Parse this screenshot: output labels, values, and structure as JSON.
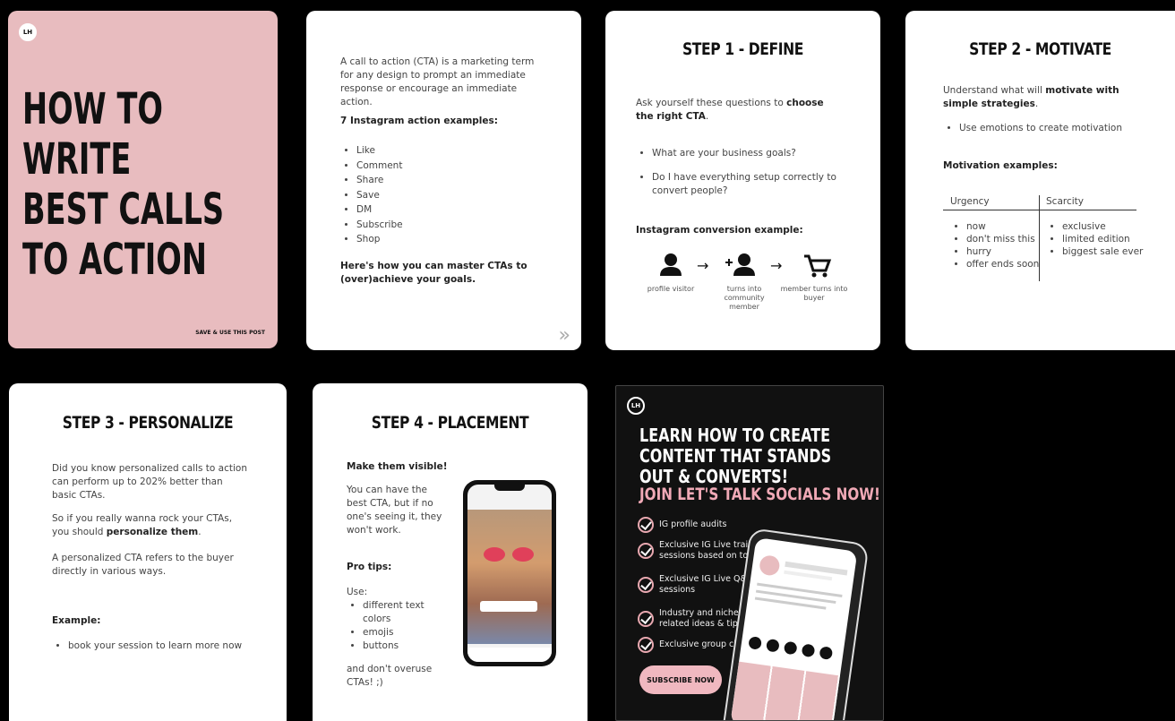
{
  "slide1": {
    "logo": "LH",
    "title_lines": [
      "HOW TO",
      "WRITE",
      "BEST CALLS",
      "TO ACTION"
    ],
    "footer": "SAVE & USE THIS POST"
  },
  "slide2": {
    "intro": "A call to action (CTA) is a marketing term for any design to prompt an immediate response or encourage an immediate action.",
    "examples_heading": "7 Instagram action examples:",
    "examples": [
      "Like",
      "Comment",
      "Share",
      "Save",
      "DM",
      "Subscribe",
      "Shop"
    ],
    "outro": "Here's how you can master CTAs to (over)achieve your goals.",
    "next_glyph": "»"
  },
  "slide3": {
    "title": "STEP 1 - DEFINE",
    "intro_plain": "Ask yourself these questions to ",
    "intro_bold": "choose the right CTA",
    "intro_end": ".",
    "questions": [
      "What are your business goals?",
      "Do I have everything setup correctly to convert people?"
    ],
    "conversion_heading": "Instagram conversion example:",
    "steps": [
      "profile visitor",
      "turns into community member",
      "member turns into buyer"
    ]
  },
  "slide4": {
    "title": "STEP 2 - MOTIVATE",
    "intro_plain": "Understand what will ",
    "intro_bold": "motivate with simple strategies",
    "intro_end": ".",
    "bullet": "Use emotions to create motivation",
    "examples_heading": "Motivation examples:",
    "col1_header": "Urgency",
    "col1_items": [
      "now",
      "don't miss this",
      "hurry",
      "offer ends soon"
    ],
    "col2_header": "Scarcity",
    "col2_items": [
      "exclusive",
      "limited edition",
      "biggest sale ever"
    ]
  },
  "slide5": {
    "title": "STEP 3 - PERSONALIZE",
    "p1": "Did you know personalized calls to action can perform up to 202% better than basic CTAs.",
    "p2_plain": "So if you really wanna rock your CTAs, you should ",
    "p2_bold": "personalize them",
    "p2_end": ".",
    "p3": "A personalized CTA refers to the buyer directly in various ways.",
    "example_heading": "Example:",
    "example": "book your session to learn more now"
  },
  "slide6": {
    "title": "STEP 4 - PLACEMENT",
    "heading": "Make them visible!",
    "p1": "You can have the best CTA, but if no one's seeing it, they won't work.",
    "tips_heading": "Pro tips:",
    "use": "Use:",
    "tips": [
      "different text colors",
      "emojis",
      "buttons"
    ],
    "outro": "and don't overuse CTAs! ;)"
  },
  "slide7": {
    "logo": "LH",
    "headline": "LEARN HOW TO CREATE CONTENT THAT STANDS OUT & CONVERTS!",
    "sub": "JOIN LET'S TALK SOCIALS NOW!",
    "features": [
      "IG profile audits",
      "Exclusive IG Live training sessions based on topics",
      "Exclusive IG Live Q&A sessions",
      "Industry and niche related ideas & tips",
      "Exclusive group chat"
    ],
    "button": "SUBSCRIBE NOW"
  },
  "colors": {
    "pink": "#e8bcbf",
    "accent_pink": "#f0a9b6",
    "dark": "#111111"
  }
}
